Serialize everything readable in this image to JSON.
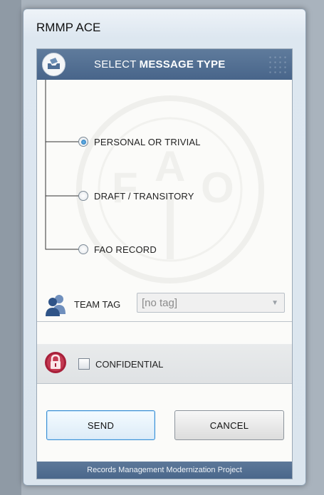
{
  "window": {
    "title": "RMMP ACE"
  },
  "header": {
    "title_prefix": "SELECT ",
    "title_bold": "MESSAGE TYPE",
    "icon": "envelope-tray-icon"
  },
  "message_types": [
    {
      "label": "PERSONAL OR TRIVIAL",
      "checked": true
    },
    {
      "label": "DRAFT / TRANSITORY",
      "checked": false
    },
    {
      "label": "FAO RECORD",
      "checked": false
    }
  ],
  "team_tag": {
    "label": "TEAM TAG",
    "value": "[no tag]",
    "icon": "team-people-icon"
  },
  "confidential": {
    "label": "CONFIDENTIAL",
    "checked": false,
    "icon": "padlock-icon"
  },
  "buttons": {
    "send": "SEND",
    "cancel": "CANCEL"
  },
  "footer": {
    "text": "Records Management Modernization Project"
  },
  "colors": {
    "header_bg": "#48658a",
    "accent_blue": "#3c8fd2",
    "lock_red": "#b1213a",
    "team_icon": "#3c5f90"
  }
}
